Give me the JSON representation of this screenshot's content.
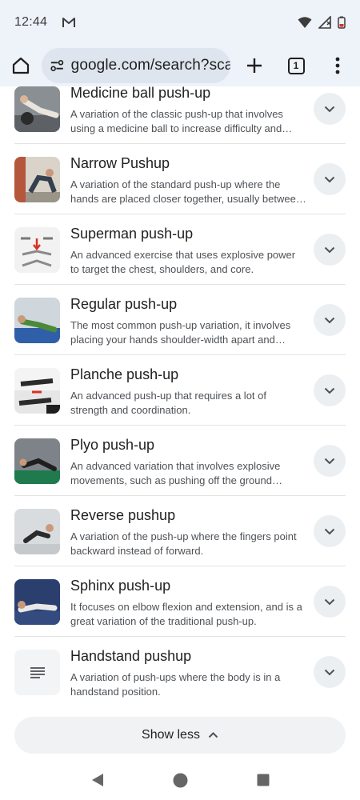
{
  "status": {
    "time": "12:44"
  },
  "browser": {
    "url": "google.com/search?sca_",
    "tab_count": "1"
  },
  "results": [
    {
      "title": "Medicine ball push-up",
      "desc1": "A variation of the classic push-up that involves",
      "desc2": "using a medicine ball to increase difficulty and…",
      "thumb": "medicine-ball-thumbnail"
    },
    {
      "title": "Narrow Pushup",
      "desc1": "A variation of the standard push-up where the",
      "desc2": "hands are placed closer together, usually betwee…",
      "thumb": "narrow-pushup-thumbnail"
    },
    {
      "title": "Superman push-up",
      "desc1": "An advanced exercise that uses explosive power",
      "desc2": "to target the chest, shoulders, and core.",
      "thumb": "superman-pushup-thumbnail"
    },
    {
      "title": "Regular push-up",
      "desc1": "The most common push-up variation, it involves",
      "desc2": "placing your hands shoulder-width apart and…",
      "thumb": "regular-pushup-thumbnail"
    },
    {
      "title": "Planche push-up",
      "desc1": "An advanced push-up that requires a lot of",
      "desc2": "strength and coordination.",
      "thumb": "planche-pushup-thumbnail"
    },
    {
      "title": "Plyo push-up",
      "desc1": "An advanced variation that involves explosive",
      "desc2": "movements, such as pushing off the ground…",
      "thumb": "plyo-pushup-thumbnail"
    },
    {
      "title": "Reverse pushup",
      "desc1": "A variation of the push-up where the fingers point",
      "desc2": "backward instead of forward.",
      "thumb": "reverse-pushup-thumbnail"
    },
    {
      "title": "Sphinx push-up",
      "desc1": "It focuses on elbow flexion and extension, and is a",
      "desc2": "great variation of the traditional push-up.",
      "thumb": "sphinx-pushup-thumbnail"
    },
    {
      "title": "Handstand pushup",
      "desc1": "A variation of push-ups where the body is in a",
      "desc2": "handstand position.",
      "thumb": "document-icon"
    }
  ],
  "show_less": {
    "label": "Show less"
  },
  "colors": {
    "chip_bg": "#eceff2",
    "toolbar_bg": "#eef2f9",
    "divider": "#e3e3e3"
  }
}
